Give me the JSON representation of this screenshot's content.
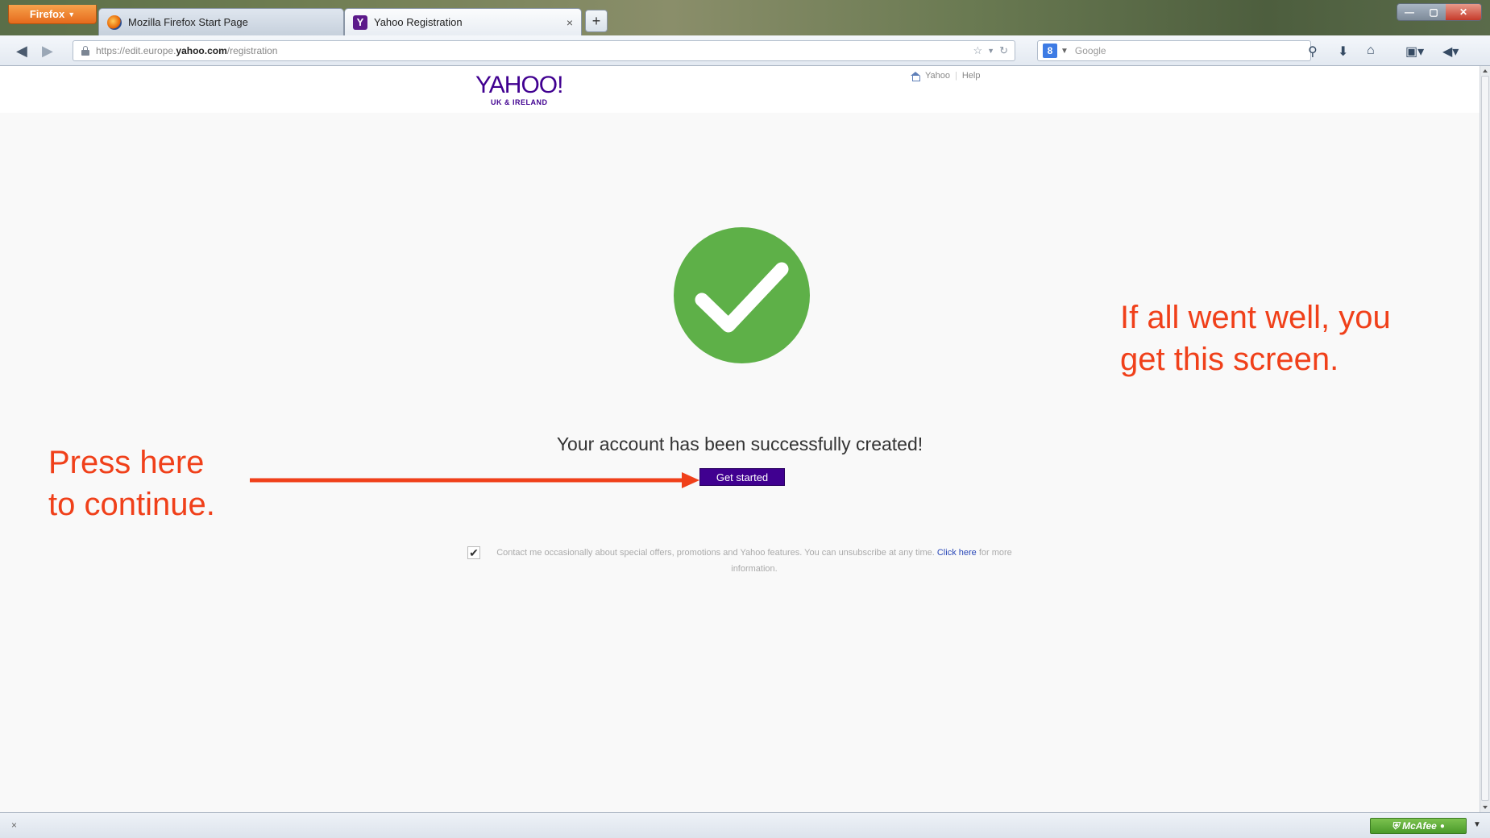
{
  "browser": {
    "menu_button_label": "Firefox",
    "tabs": [
      {
        "title": "Mozilla Firefox Start Page",
        "active": false
      },
      {
        "title": "Yahoo Registration",
        "active": true
      }
    ],
    "new_tab_glyph": "+",
    "close_tab_glyph": "×",
    "url_prefix": "https://edit.europe.",
    "url_domain": "yahoo.com",
    "url_path": "/registration",
    "search_engine": "Google",
    "search_placeholder": "Google"
  },
  "page": {
    "logo_main": "YAHOO!",
    "logo_sub": "UK & IRELAND",
    "header_links": {
      "home": "Yahoo",
      "help": "Help"
    },
    "success_message": "Your account has been successfully created!",
    "get_started_label": "Get started",
    "consent_checked": true,
    "consent_text_before": "Contact me occasionally about special offers, promotions and Yahoo features. You can unsubscribe at any time.",
    "consent_link": "Click here",
    "consent_text_after": "for more information."
  },
  "statusbar": {
    "close_glyph": "×",
    "mcafee_label": "McAfee"
  },
  "annotations": {
    "left_line1": "Press here",
    "left_line2": "to continue.",
    "right_line1": "If all went well, you",
    "right_line2": "get this screen."
  },
  "colors": {
    "yahoo_purple": "#400090",
    "success_green": "#5eb048",
    "annotation_red": "#f0401a"
  },
  "icons": [
    "firefox-icon",
    "yahoo-favicon",
    "lock-icon",
    "star-icon",
    "reload-icon",
    "google-icon",
    "search-icon",
    "download-icon",
    "home-icon",
    "bookmarks-icon",
    "pocket-icon",
    "checkmark-icon",
    "mcafee-icon"
  ]
}
